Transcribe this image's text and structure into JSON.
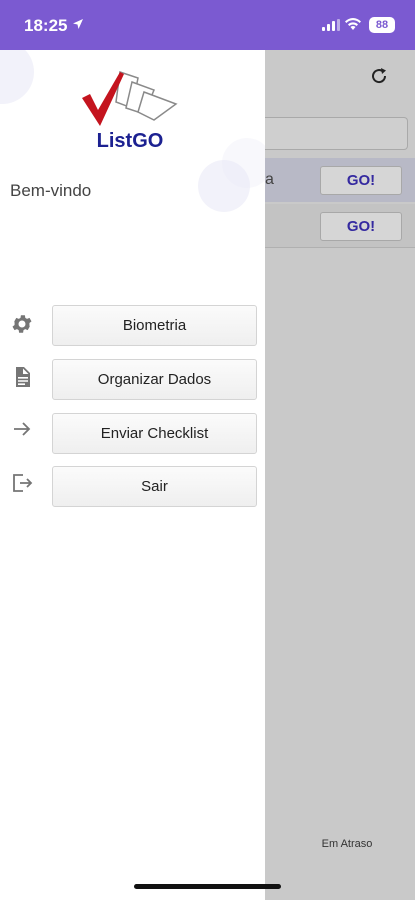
{
  "status_bar": {
    "time": "18:25",
    "battery": "88"
  },
  "drawer": {
    "logo_text": "ListGO",
    "welcome": "Bem-vindo",
    "menu": [
      {
        "icon": "gear-icon",
        "label": "Biometria"
      },
      {
        "icon": "document-icon",
        "label": "Organizar Dados"
      },
      {
        "icon": "arrow-right-icon",
        "label": "Enviar Checklist"
      },
      {
        "icon": "logout-icon",
        "label": "Sair"
      }
    ]
  },
  "background": {
    "row1_text": "a",
    "go_label": "GO!",
    "footer": "Em Atraso"
  },
  "colors": {
    "status_bar": "#7b5ad1",
    "logo_blue": "#1c2191",
    "logo_red": "#c4141e",
    "go_text": "#352aa0"
  }
}
